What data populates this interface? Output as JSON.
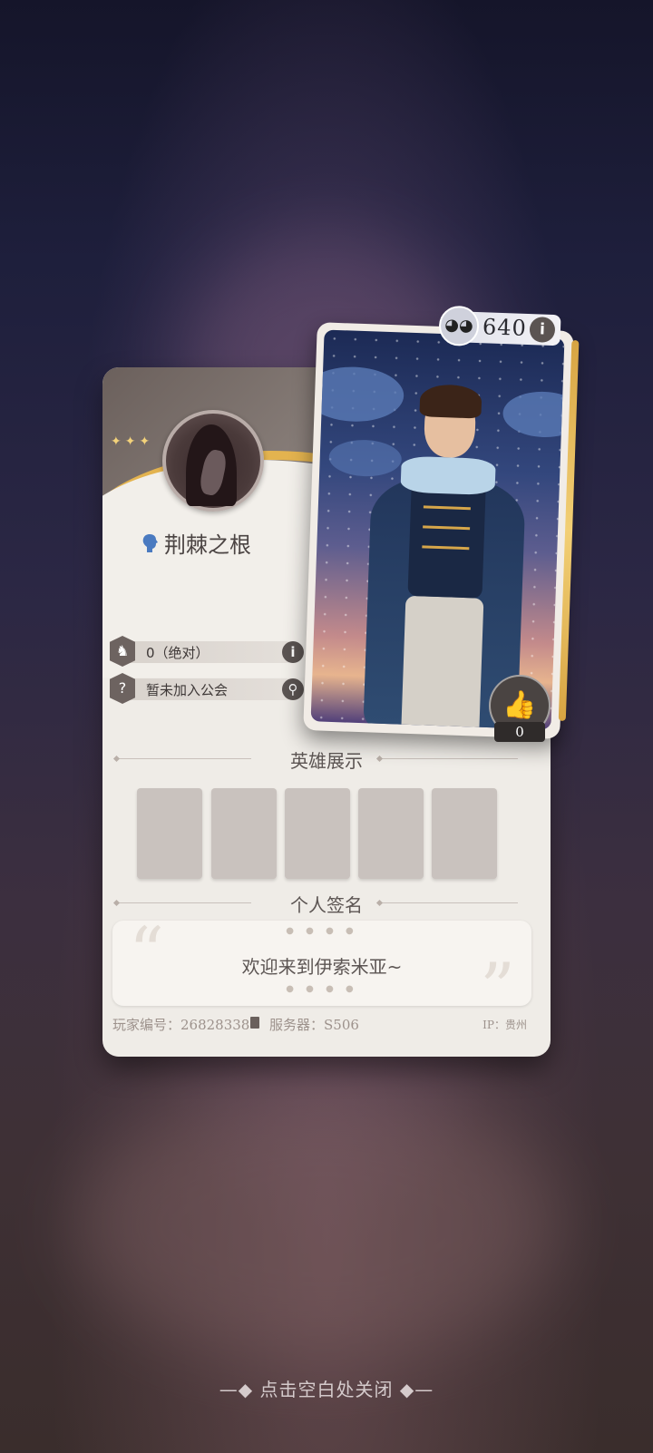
{
  "player": {
    "name": "荆棘之根",
    "stat_value": "0（绝对）",
    "guild_status": "暂未加入公会",
    "id_label": "玩家编号：26828338",
    "server_label": "服务器：S506",
    "ip_label": "IP：贵州"
  },
  "portrait": {
    "rating": "640",
    "likes": "0"
  },
  "sections": {
    "heroes_title": "英雄展示",
    "signature_title": "个人签名"
  },
  "signature": {
    "text": "欢迎来到伊索米亚~"
  },
  "close_hint": "—◆ 点击空白处关闭 ◆—",
  "colors": {
    "accent_gold": "#e3b34f",
    "card_bg": "#efece7"
  },
  "icons": {
    "rating": "mask-icon",
    "info": "info-icon",
    "search": "search-icon",
    "like": "thumbs-up-icon"
  }
}
